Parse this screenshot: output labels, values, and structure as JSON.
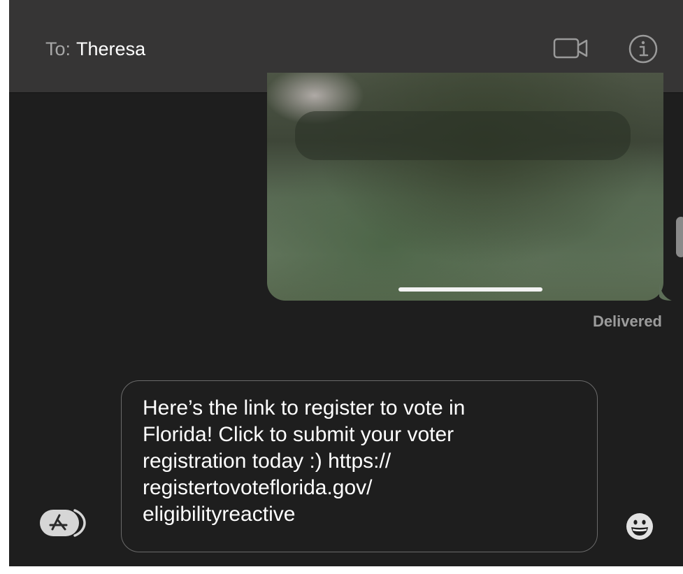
{
  "header": {
    "to_label": "To:",
    "recipient": "Theresa",
    "video_icon": "video-camera-icon",
    "info_icon": "info-icon"
  },
  "thread": {
    "image_message": {
      "status": "Delivered"
    }
  },
  "composer": {
    "apps_icon": "app-store-icon",
    "text": "Here’s the link to register to vote in\nFlorida! Click to submit your voter\nregistration today :) https://\nregistertovoteflorida.gov/\neligibilityreactive",
    "emoji_icon": "emoji-icon"
  },
  "colors": {
    "header_bg": "#363535",
    "window_bg": "#1e1e1e",
    "status_text": "#9c9c9c"
  }
}
